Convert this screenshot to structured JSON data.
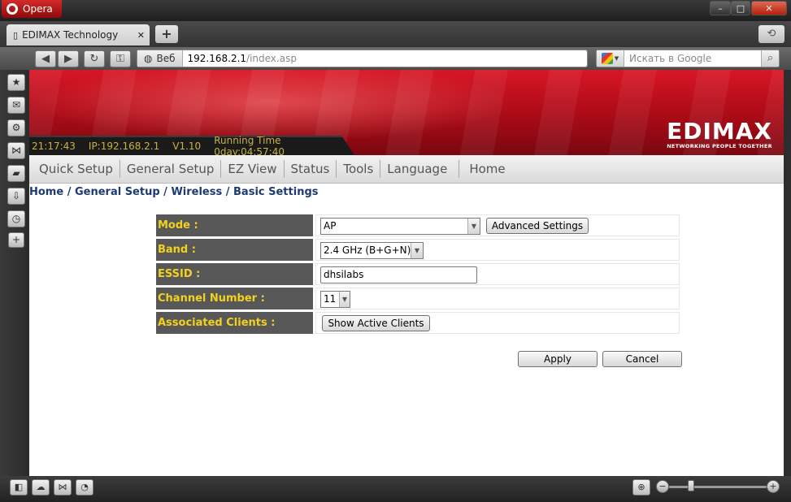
{
  "browser": {
    "menu_label": "Opera",
    "tab_title": "EDIMAX Technology",
    "tab_close": "✕",
    "new_tab": "+",
    "address": {
      "badge": "Веб",
      "host": "192.168.2.1",
      "path": "/index.asp"
    },
    "search_placeholder": "Искать в Google",
    "window_controls": {
      "minimize": "–",
      "maximize": "□",
      "close": "✕"
    }
  },
  "router": {
    "status_strip": {
      "time": "21:17:43",
      "ip": "IP:192.168.2.1",
      "version": "V1.10",
      "running_time": "Running Time 0day:04:57:40"
    },
    "logo": {
      "main": "EDIMAX",
      "tagline": "NETWORKING PEOPLE TOGETHER"
    },
    "menu": [
      "Quick Setup",
      "General Setup",
      "EZ View",
      "Status",
      "Tools",
      "Language",
      "Home"
    ],
    "breadcrumb": "Home / General Setup / Wireless / Basic Settings",
    "form": {
      "mode": {
        "label": "Mode :",
        "value": "AP",
        "button": "Advanced Settings"
      },
      "band": {
        "label": "Band :",
        "value": "2.4 GHz (B+G+N)"
      },
      "essid": {
        "label": "ESSID :",
        "value": "dhsilabs"
      },
      "channel": {
        "label": "Channel Number :",
        "value": "11"
      },
      "clients": {
        "label": "Associated Clients :",
        "button": "Show Active Clients"
      }
    },
    "actions": {
      "apply": "Apply",
      "cancel": "Cancel"
    }
  },
  "icons": {
    "sidebar": [
      "bookmarks-icon",
      "mail-icon",
      "settings-icon",
      "unite-icon",
      "notes-icon",
      "downloads-icon",
      "history-icon",
      "add-panel-icon"
    ],
    "bottom": [
      "panel-toggle-icon",
      "cloud-icon",
      "unite-status-icon",
      "speed-dial-icon",
      "zoom-icon"
    ]
  }
}
